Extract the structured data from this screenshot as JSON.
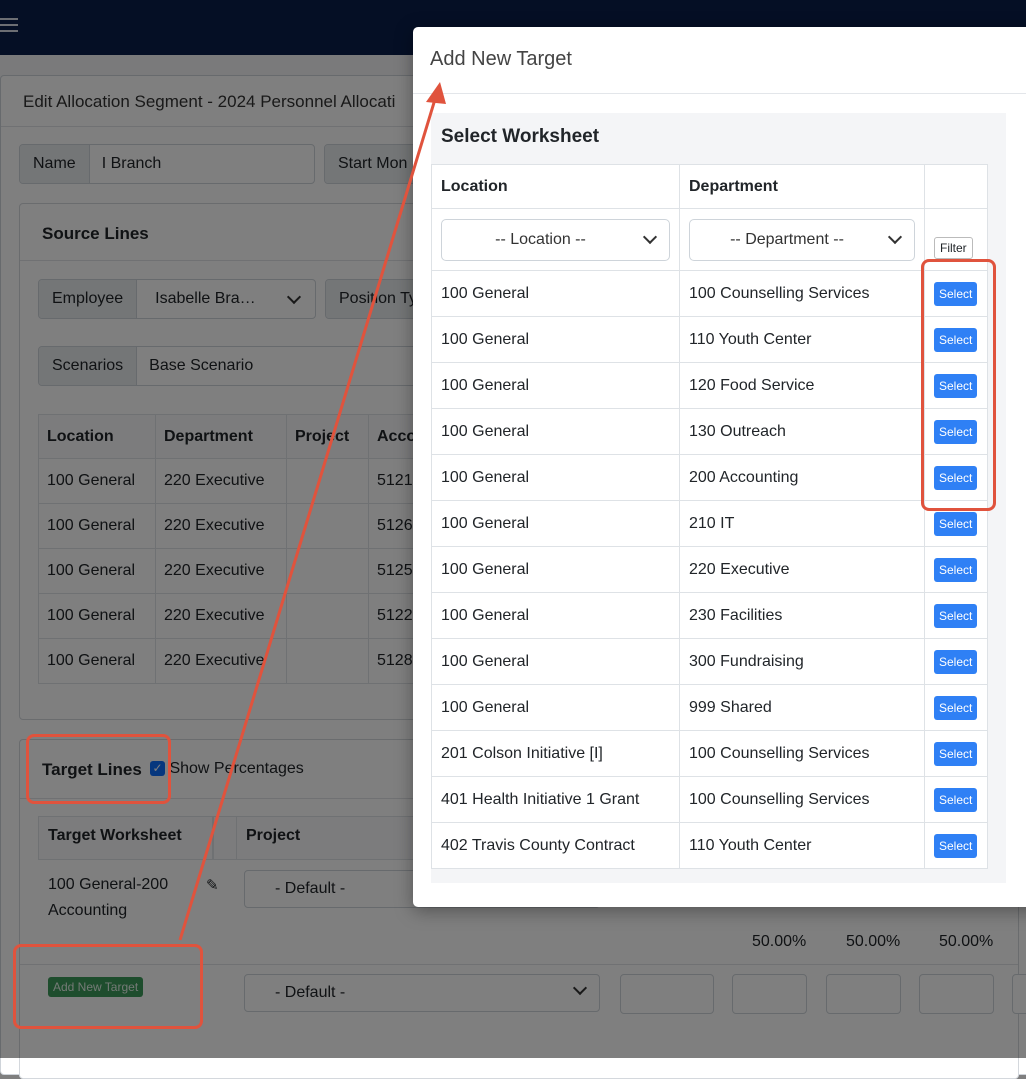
{
  "app": {
    "page_title": "Edit Allocation Segment - 2024 Personnel Allocati",
    "name_label": "Name",
    "name_value": "I Branch",
    "start_month_label": "Start Mon",
    "source_lines": {
      "title": "Source Lines",
      "employee_label": "Employee",
      "employee_value": "Isabelle Bra…",
      "position_type_label": "Position Ty",
      "scenarios_label": "Scenarios",
      "scenarios_value": "Base Scenario",
      "columns": [
        "Location",
        "Department",
        "Project",
        "Acco"
      ],
      "rows": [
        [
          "100 General",
          "220 Executive",
          "",
          "5121"
        ],
        [
          "100 General",
          "220 Executive",
          "",
          "5126"
        ],
        [
          "100 General",
          "220 Executive",
          "",
          "5125"
        ],
        [
          "100 General",
          "220 Executive",
          "",
          "5122"
        ],
        [
          "100 General",
          "220 Executive",
          "",
          "5128"
        ]
      ]
    },
    "target_lines": {
      "title": "Target Lines",
      "show_percentages_label": "Show Percentages",
      "show_percentages_checked": true,
      "columns": [
        "Target Worksheet",
        "Project"
      ],
      "row_worksheet": "100 General-200 Accounting",
      "project_default": "- Default -",
      "percentages": [
        "50.00%",
        "50.00%",
        "50.00%"
      ],
      "add_new_target_label": "Add New Target"
    }
  },
  "modal": {
    "title": "Add New Target",
    "worksheet_title": "Select Worksheet",
    "columns": [
      "Location",
      "Department",
      ""
    ],
    "location_placeholder": "-- Location --",
    "department_placeholder": "-- Department --",
    "filter_label": "Filter",
    "select_label": "Select",
    "rows": [
      {
        "location": "100 General",
        "department": "100 Counselling Services"
      },
      {
        "location": "100 General",
        "department": "110 Youth Center"
      },
      {
        "location": "100 General",
        "department": "120 Food Service"
      },
      {
        "location": "100 General",
        "department": "130 Outreach"
      },
      {
        "location": "100 General",
        "department": "200 Accounting"
      },
      {
        "location": "100 General",
        "department": "210 IT"
      },
      {
        "location": "100 General",
        "department": "220 Executive"
      },
      {
        "location": "100 General",
        "department": "230 Facilities"
      },
      {
        "location": "100 General",
        "department": "300 Fundraising"
      },
      {
        "location": "100 General",
        "department": "999 Shared"
      },
      {
        "location": "201 Colson Initiative [I]",
        "department": "100 Counselling Services"
      },
      {
        "location": "401 Health Initiative 1 Grant",
        "department": "100 Counselling Services"
      },
      {
        "location": "402 Travis County Contract",
        "department": "110 Youth Center"
      }
    ]
  },
  "colors": {
    "topbar": "#0b1f4b",
    "annotation": "#e0533d",
    "select_button": "#2f80f5",
    "add_button": "#3c9a5a"
  }
}
